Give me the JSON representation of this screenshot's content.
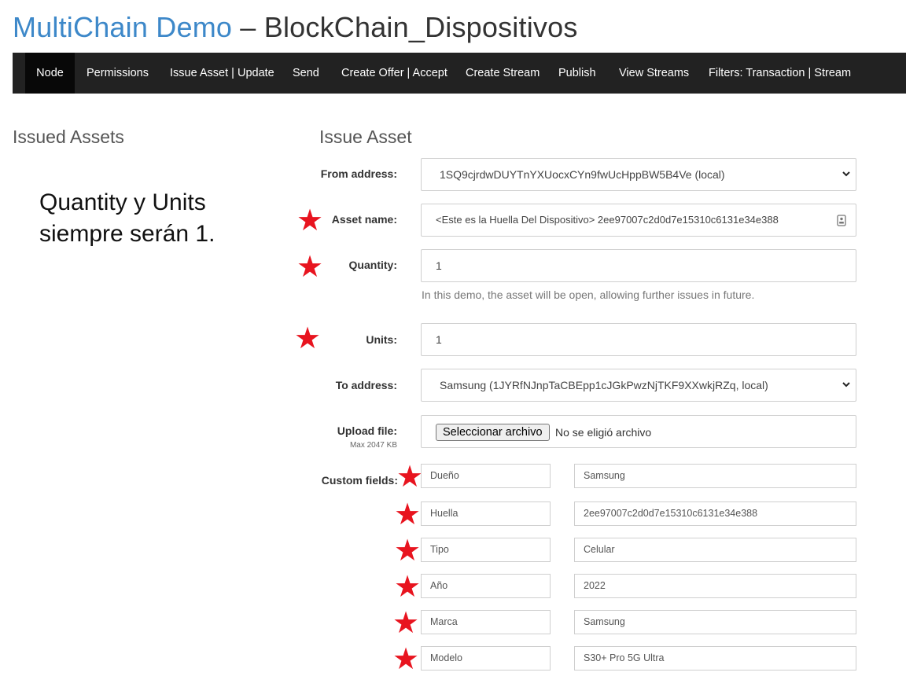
{
  "header": {
    "brand": "MultiChain Demo",
    "separator": " – ",
    "chain_name": "BlockChain_Dispositivos"
  },
  "nav": {
    "items": [
      {
        "label": "Node",
        "active": true
      },
      {
        "label": "Permissions"
      },
      {
        "label": "Issue Asset | Update"
      },
      {
        "label": "Send"
      },
      {
        "label": "Create Offer | Accept"
      },
      {
        "label": "Create Stream"
      },
      {
        "label": "Publish"
      },
      {
        "label": "View Streams"
      },
      {
        "label": "Filters: Transaction | Stream"
      }
    ]
  },
  "left": {
    "title": "Issued Assets",
    "note_line1": "Quantity y Units",
    "note_line2": "siempre serán 1."
  },
  "form": {
    "title": "Issue Asset",
    "from_address": {
      "label": "From address:",
      "value": "1SQ9cjrdwDUYTnYXUocxCYn9fwUcHppBW5B4Ve (local)"
    },
    "asset_name": {
      "label": "Asset name:",
      "value": "<Este es la Huella Del Dispositivo> 2ee97007c2d0d7e15310c6131e34e388"
    },
    "quantity": {
      "label": "Quantity:",
      "value": "1",
      "help": "In this demo, the asset will be open, allowing further issues in future."
    },
    "units": {
      "label": "Units:",
      "value": "1"
    },
    "to_address": {
      "label": "To address:",
      "value": "Samsung (1JYRfNJnpTaCBEpp1cJGkPwzNjTKF9XXwkjRZq, local)"
    },
    "upload": {
      "label": "Upload file:",
      "sublabel": "Max 2047 KB",
      "button": "Seleccionar archivo",
      "status": "No se eligió archivo"
    },
    "custom_fields": {
      "label": "Custom fields:",
      "rows": [
        {
          "key": "Dueño",
          "value": "Samsung"
        },
        {
          "key": "Huella",
          "value": "2ee97007c2d0d7e15310c6131e34e388"
        },
        {
          "key": "Tipo",
          "value": "Celular"
        },
        {
          "key": "Año",
          "value": "2022"
        },
        {
          "key": "Marca",
          "value": "Samsung"
        },
        {
          "key": "Modelo",
          "value": "S30+ Pro 5G Ultra"
        }
      ]
    }
  },
  "colors": {
    "brand": "#3d88c9",
    "nav_bg": "#222222",
    "nav_active": "#080808",
    "star": "#e8141f"
  },
  "icons": {
    "required": "star-icon",
    "select": "chevron-down-icon",
    "field_action": "contact-card-icon"
  }
}
